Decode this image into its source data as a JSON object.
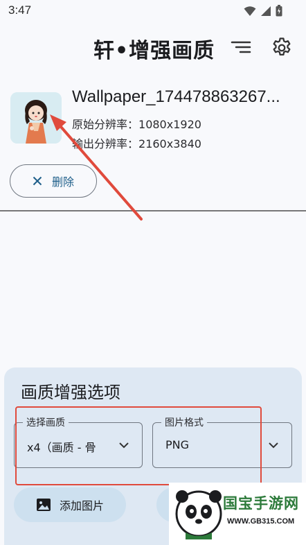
{
  "status_bar": {
    "time": "3:47"
  },
  "header": {
    "title": "轩•增强画质",
    "menu_icon": "list-filter-icon",
    "settings_icon": "gear-icon"
  },
  "image_item": {
    "file_name": "Wallpaper_174478863267...",
    "original_resolution_label": "原始分辨率：",
    "original_resolution": "1080x1920",
    "output_resolution_label": "输出分辨率：",
    "output_resolution": "2160x3840",
    "delete_label": "删除"
  },
  "options": {
    "title": "画质增强选项",
    "quality_label": "选择画质",
    "quality_value": "x4（画质 - 骨",
    "format_label": "图片格式",
    "format_value": "PNG",
    "add_image_label": "添加图片"
  },
  "watermark": {
    "text": "国宝手游网",
    "url": "WWW.GB315.COM"
  },
  "colors": {
    "background": "#f8f9fc",
    "panel": "#dee8f3",
    "accent": "#1f5f8a",
    "annotation_red": "#e04a3c"
  }
}
